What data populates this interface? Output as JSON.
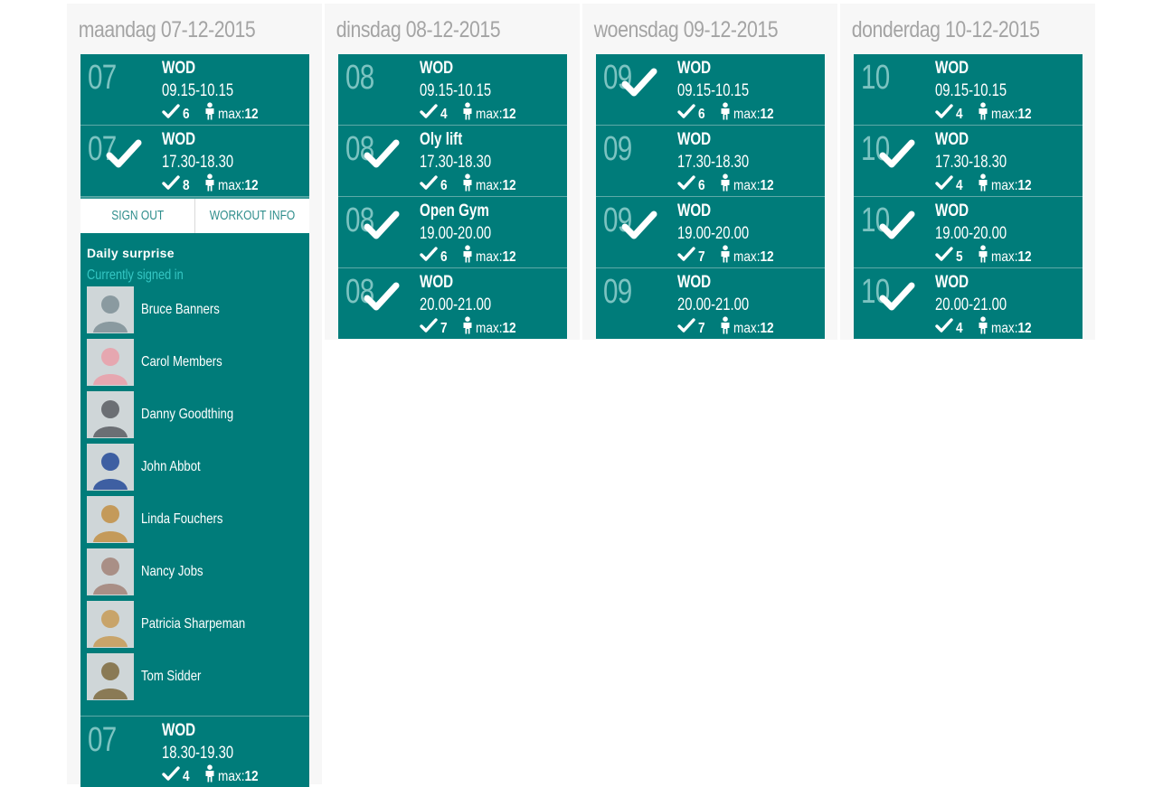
{
  "days": [
    {
      "title": "maandag 07-12-2015",
      "slots": [
        {
          "day": "07",
          "name": "WOD",
          "time": "09.15-10.15",
          "count": "6",
          "max_label": "max:",
          "max": "12",
          "signed": false
        },
        {
          "day": "07",
          "name": "WOD",
          "time": "17.30-18.30",
          "count": "8",
          "max_label": "max:",
          "max": "12",
          "signed": true
        }
      ],
      "expanded": {
        "sign_out": "SIGN OUT",
        "workout_info": "WORKOUT INFO",
        "title": "Daily surprise",
        "signed_in_label": "Currently signed in",
        "members": [
          {
            "name": "Bruce Banners",
            "tone": "#8a9aa0"
          },
          {
            "name": "Carol Members",
            "tone": "#e6a7b0"
          },
          {
            "name": "Danny Goodthing",
            "tone": "#6b6f74"
          },
          {
            "name": "John Abbot",
            "tone": "#3e5fa2"
          },
          {
            "name": "Linda Fouchers",
            "tone": "#c49a5a"
          },
          {
            "name": "Nancy Jobs",
            "tone": "#a98f86"
          },
          {
            "name": "Patricia Sharpeman",
            "tone": "#c8a46a"
          },
          {
            "name": "Tom Sidder",
            "tone": "#8a7a55"
          }
        ]
      },
      "after": [
        {
          "day": "07",
          "name": "WOD",
          "time": "18.30-19.30",
          "count": "4",
          "max_label": "max:",
          "max": "12",
          "signed": false
        }
      ]
    },
    {
      "title": "dinsdag 08-12-2015",
      "slots": [
        {
          "day": "08",
          "name": "WOD",
          "time": "09.15-10.15",
          "count": "4",
          "max_label": "max:",
          "max": "12",
          "signed": false
        },
        {
          "day": "08",
          "name": "Oly lift",
          "time": "17.30-18.30",
          "count": "6",
          "max_label": "max:",
          "max": "12",
          "signed": true
        },
        {
          "day": "08",
          "name": "Open Gym",
          "time": "19.00-20.00",
          "count": "6",
          "max_label": "max:",
          "max": "12",
          "signed": true
        },
        {
          "day": "08",
          "name": "WOD",
          "time": "20.00-21.00",
          "count": "7",
          "max_label": "max:",
          "max": "12",
          "signed": true
        }
      ]
    },
    {
      "title": "woensdag 09-12-2015",
      "slots": [
        {
          "day": "09",
          "name": "WOD",
          "time": "09.15-10.15",
          "count": "6",
          "max_label": "max:",
          "max": "12",
          "signed": true
        },
        {
          "day": "09",
          "name": "WOD",
          "time": "17.30-18.30",
          "count": "6",
          "max_label": "max:",
          "max": "12",
          "signed": false
        },
        {
          "day": "09",
          "name": "WOD",
          "time": "19.00-20.00",
          "count": "7",
          "max_label": "max:",
          "max": "12",
          "signed": true
        },
        {
          "day": "09",
          "name": "WOD",
          "time": "20.00-21.00",
          "count": "7",
          "max_label": "max:",
          "max": "12",
          "signed": false
        }
      ]
    },
    {
      "title": "donderdag 10-12-2015",
      "slots": [
        {
          "day": "10",
          "name": "WOD",
          "time": "09.15-10.15",
          "count": "4",
          "max_label": "max:",
          "max": "12",
          "signed": false
        },
        {
          "day": "10",
          "name": "WOD",
          "time": "17.30-18.30",
          "count": "4",
          "max_label": "max:",
          "max": "12",
          "signed": true
        },
        {
          "day": "10",
          "name": "WOD",
          "time": "19.00-20.00",
          "count": "5",
          "max_label": "max:",
          "max": "12",
          "signed": true
        },
        {
          "day": "10",
          "name": "WOD",
          "time": "20.00-21.00",
          "count": "4",
          "max_label": "max:",
          "max": "12",
          "signed": true
        }
      ]
    }
  ],
  "colors": {
    "slot_bg": "#007c7a",
    "accent": "#35c7c4",
    "title": "#a4a4a4"
  },
  "icons": {
    "signed": "checkmark-icon",
    "count": "check-icon",
    "capacity": "person-icon"
  }
}
